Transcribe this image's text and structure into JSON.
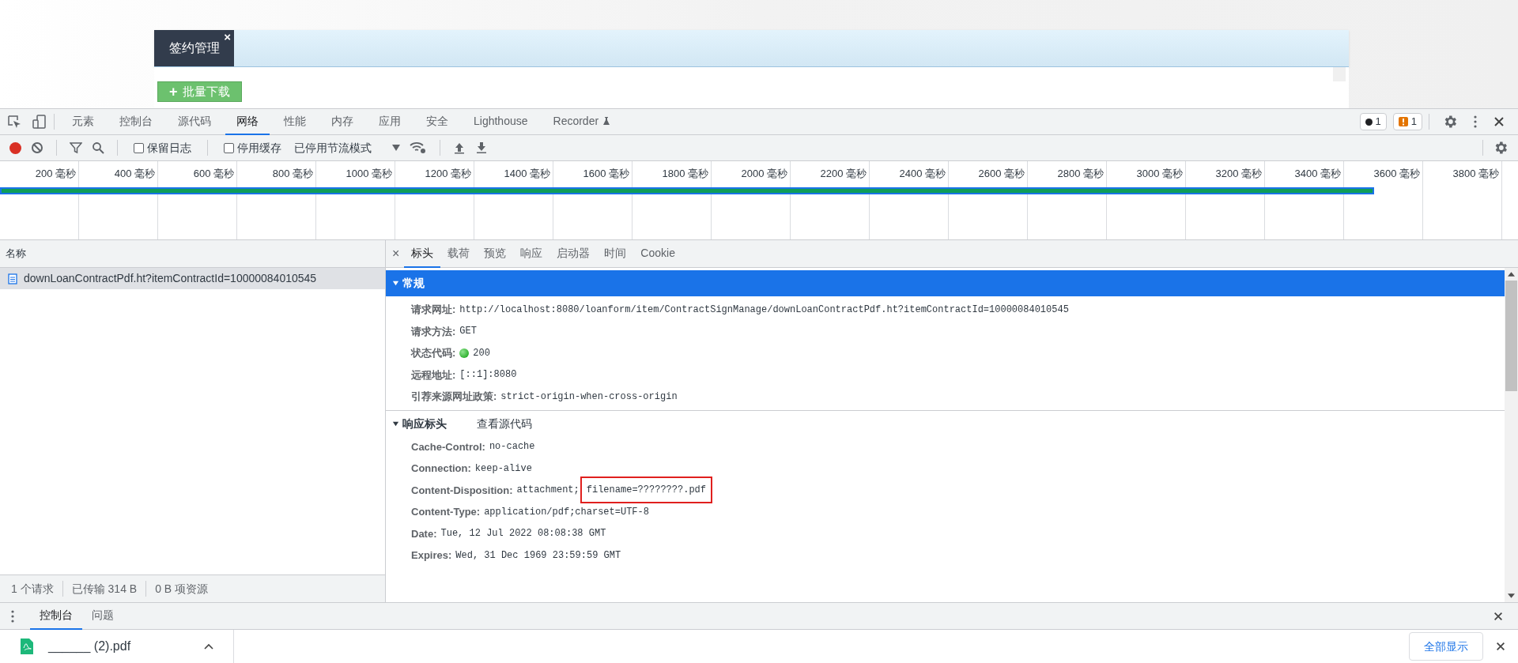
{
  "page": {
    "tab": {
      "label": "签约管理",
      "close": "×"
    },
    "button": {
      "icon": "+",
      "label": "批量下载"
    }
  },
  "devtools": {
    "tabs": [
      {
        "label": "元素",
        "selected": false
      },
      {
        "label": "控制台",
        "selected": false
      },
      {
        "label": "源代码",
        "selected": false
      },
      {
        "label": "网络",
        "selected": true
      },
      {
        "label": "性能",
        "selected": false
      },
      {
        "label": "内存",
        "selected": false
      },
      {
        "label": "应用",
        "selected": false
      },
      {
        "label": "安全",
        "selected": false
      },
      {
        "label": "Lighthouse",
        "selected": false
      },
      {
        "label": "Recorder",
        "selected": false
      }
    ],
    "errors": "1",
    "warnings": "1",
    "toolbar": {
      "recording": true,
      "preserve_log": {
        "label": "保留日志",
        "checked": false
      },
      "disable_cache": {
        "label": "停用缓存",
        "checked": false
      },
      "throttling": "已停用节流模式"
    },
    "timeline": {
      "ticks": [
        "200 毫秒",
        "400 毫秒",
        "600 毫秒",
        "800 毫秒",
        "1000 毫秒",
        "1200 毫秒",
        "1400 毫秒",
        "1600 毫秒",
        "1800 毫秒",
        "2000 毫秒",
        "2200 毫秒",
        "2400 毫秒",
        "2600 毫秒",
        "2800 毫秒",
        "3000 毫秒",
        "3200 毫秒",
        "3400 毫秒",
        "3600 毫秒",
        "3800 毫秒"
      ],
      "level": 0.905
    },
    "requests": {
      "column": "名称",
      "rows": [
        {
          "name": "downLoanContractPdf.ht?itemContractId=10000084010545",
          "selected": true
        }
      ],
      "status": [
        "1 个请求",
        "已传输 314 B",
        "0 B 项资源"
      ]
    },
    "detail": {
      "close": "×",
      "tabs": [
        {
          "label": "标头",
          "selected": true
        },
        {
          "label": "载荷",
          "selected": false
        },
        {
          "label": "预览",
          "selected": false
        },
        {
          "label": "响应",
          "selected": false
        },
        {
          "label": "启动器",
          "selected": false
        },
        {
          "label": "时间",
          "selected": false
        },
        {
          "label": "Cookie",
          "selected": false
        }
      ],
      "general": {
        "title": "常规",
        "expanded": true,
        "rows": [
          {
            "name": "请求网址:",
            "value": "http://localhost:8080/loanform/item/ContractSignManage/downLoanContractPdf.ht?itemContractId=10000084010545"
          },
          {
            "name": "请求方法:",
            "value": "GET"
          },
          {
            "name": "状态代码:",
            "value": "200",
            "kind": "status"
          },
          {
            "name": "远程地址:",
            "value": "[::1]:8080"
          },
          {
            "name": "引荐来源网址政策:",
            "value": "strict-origin-when-cross-origin"
          }
        ]
      },
      "response_headers": {
        "title": "响应标头",
        "expanded": true,
        "link": "查看源代码",
        "rows": [
          {
            "name": "Cache-Control:",
            "value": "no-cache"
          },
          {
            "name": "Connection:",
            "value": "keep-alive"
          },
          {
            "name": "Content-Disposition:",
            "value": "attachment;",
            "highlight": "filename=????????.pdf"
          },
          {
            "name": "Content-Type:",
            "value": "application/pdf;charset=UTF-8"
          },
          {
            "name": "Date:",
            "value": "Tue, 12 Jul 2022 08:08:38 GMT"
          },
          {
            "name": "Expires:",
            "value": "Wed, 31 Dec 1969 23:59:59 GMT"
          }
        ]
      }
    },
    "drawer": {
      "tabs": [
        {
          "label": "控制台",
          "selected": true
        },
        {
          "label": "问题",
          "selected": false
        }
      ]
    }
  },
  "downloads": {
    "file": "______ (2).pdf",
    "show_all": "全部显示"
  }
}
